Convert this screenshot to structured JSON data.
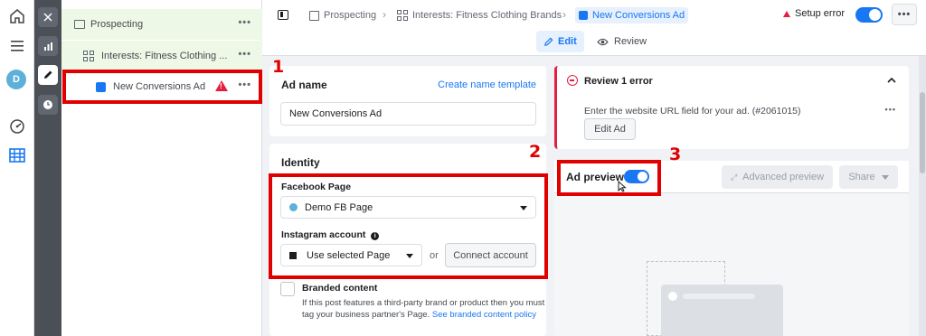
{
  "rail": {
    "avatar_letter": "D"
  },
  "tree": {
    "campaign": "Prospecting",
    "adset": "Interests: Fitness Clothing ...",
    "ad": "New Conversions Ad",
    "more": "•••"
  },
  "breadcrumb": {
    "campaign": "Prospecting",
    "adset": "Interests: Fitness Clothing Brands",
    "ad": "New Conversions Ad",
    "sep": "›"
  },
  "header": {
    "setup_error": "Setup error",
    "more": "•••",
    "edit_tab": "Edit",
    "review_tab": "Review"
  },
  "ad_name": {
    "title": "Ad name",
    "template_link": "Create name template",
    "value": "New Conversions Ad"
  },
  "identity": {
    "title": "Identity",
    "fb_label": "Facebook Page",
    "fb_value": "Demo FB Page",
    "ig_label": "Instagram account",
    "ig_value": "Use selected Page",
    "or": "or",
    "connect": "Connect account",
    "branded_title": "Branded content",
    "branded_desc_1": "If this post features a third-party brand or product then you must",
    "branded_desc_2": "tag your business partner's Page.",
    "branded_link": "See branded content policy"
  },
  "review": {
    "title": "Review 1 error",
    "message": "Enter the website URL field for your ad. (#2061015)",
    "more": "•••",
    "edit_ad": "Edit Ad"
  },
  "preview": {
    "label": "Ad preview",
    "advanced": "Advanced preview",
    "share": "Share"
  },
  "annotations": {
    "n1": "1",
    "n2": "2",
    "n3": "3"
  },
  "colors": {
    "accent": "#1877f2",
    "error": "#e41e3f",
    "annotation": "#e00000"
  }
}
